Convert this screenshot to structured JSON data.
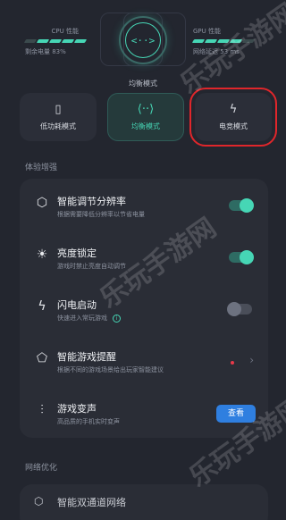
{
  "header": {
    "cpu": {
      "title": "CPU 性能",
      "sub": "剩余电量 83%",
      "level": 0.6
    },
    "gpu": {
      "title": "GPU 性能",
      "sub": "网络延迟 53 ms",
      "level": 0.6
    },
    "center_glyph": "<··>",
    "current_mode": "均衡模式"
  },
  "modes": [
    {
      "label": "低功耗模式",
      "icon": "battery-icon"
    },
    {
      "label": "均衡模式",
      "icon": "balance-icon",
      "active": true
    },
    {
      "label": "电竞模式",
      "icon": "lightning-icon"
    }
  ],
  "section1": "体验增强",
  "features": [
    {
      "name": "智能调节分辨率",
      "desc": "根据需要降低分辨率以节省电量",
      "control": "toggle",
      "on": true,
      "icon": "resolution-icon"
    },
    {
      "name": "亮度锁定",
      "desc": "游戏时禁止亮度自动调节",
      "control": "toggle",
      "on": true,
      "icon": "brightness-icon"
    },
    {
      "name": "闪电启动",
      "desc": "快速进入常玩游戏",
      "control": "toggle",
      "on": false,
      "icon": "flash-start-icon"
    },
    {
      "name": "智能游戏提醒",
      "desc": "根据不同的游戏场景给出玩家智能建议",
      "control": "chevron",
      "icon": "bulb-icon"
    },
    {
      "name": "游戏变声",
      "desc": "高品质的手机实时变声",
      "control": "button",
      "button_label": "查看",
      "icon": "voice-wave-icon"
    }
  ],
  "section2": "网络优化",
  "network_item": "智能双通道网络",
  "watermark": "乐玩手游网",
  "colors": {
    "accent": "#46d6b5",
    "button": "#2f7fe0",
    "highlight": "#e0262b"
  }
}
